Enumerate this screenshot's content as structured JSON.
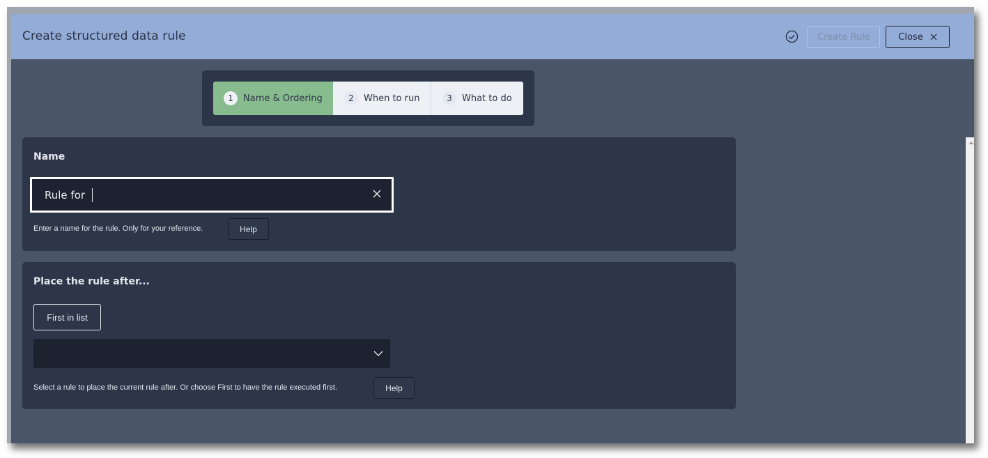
{
  "dialog": {
    "title": "Create structured data rule",
    "header_icon": "check-circle-icon",
    "create_button_label": "Create Rule",
    "close_button_label": "Close",
    "close_icon": "close-icon",
    "accent_color": "#94acd8"
  },
  "stepper": {
    "steps": [
      {
        "number": "1",
        "label": "Name & Ordering",
        "active": true
      },
      {
        "number": "2",
        "label": "When to run",
        "active": false
      },
      {
        "number": "3",
        "label": "What to do",
        "active": false
      }
    ],
    "active_color": "#88bc8f"
  },
  "name_section": {
    "title": "Name",
    "input_value": "Rule for ",
    "clear_icon": "close-icon",
    "hint": "Enter a name for the rule. Only for your reference.",
    "help_label": "Help"
  },
  "order_section": {
    "title": "Place the rule after...",
    "first_button_label": "First in list",
    "select_value": "",
    "select_icon": "chevron-down-icon",
    "hint": "Select a rule to place the current rule after. Or choose First to have the rule executed first.",
    "help_label": "Help"
  }
}
